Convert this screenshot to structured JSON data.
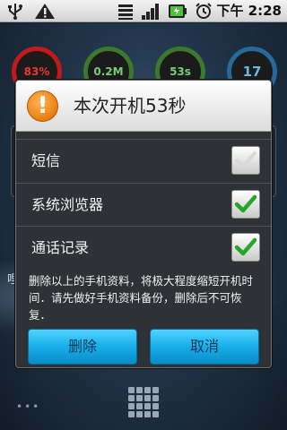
{
  "status_bar": {
    "time": "下午 2:28",
    "icons": [
      "usb-icon",
      "warning-icon",
      "signal-bars-icon",
      "cell-signal-icon",
      "battery-icon",
      "alarm-icon"
    ]
  },
  "background": {
    "gauges": [
      {
        "value": "83%",
        "color": "#c21a1a"
      },
      {
        "value": "0.2M",
        "color": "#3a7a2a"
      },
      {
        "value": "53s",
        "color": "#3a7a2a"
      },
      {
        "value": "17",
        "color": "#246a9a"
      }
    ],
    "side_text": "哩"
  },
  "dialog": {
    "title": "本次开机53秒",
    "options": [
      {
        "label": "短信",
        "checked": false
      },
      {
        "label": "系统浏览器",
        "checked": true
      },
      {
        "label": "通话记录",
        "checked": true
      }
    ],
    "message": "删除以上的手机资料，将极大程度缩短开机时间．请先做好手机资料备份，删除后不可恢复．",
    "buttons": {
      "delete": "删除",
      "cancel": "取消"
    }
  },
  "colors": {
    "accent_button": "#18aee8",
    "check_green": "#2aa52a",
    "warning_orange": "#f08a1e"
  }
}
